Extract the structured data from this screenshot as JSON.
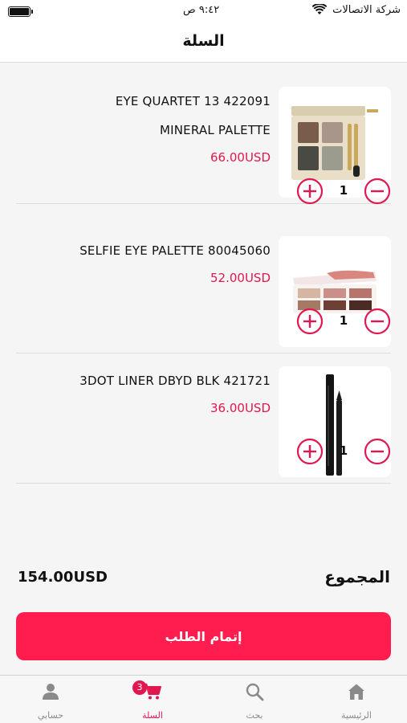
{
  "status_bar": {
    "carrier": "شركة الاتصالات",
    "time": "٩:٤٢ ص"
  },
  "header": {
    "title": "السلة"
  },
  "cart": {
    "items": [
      {
        "name_line1": "422091 13 EYE QUARTET",
        "name_line2": "MINERAL PALETTE",
        "price": "66.00USD",
        "quantity": "1"
      },
      {
        "name_line1": "80045060 SELFIE EYE PALETTE",
        "name_line2": "",
        "price": "52.00USD",
        "quantity": "1"
      },
      {
        "name_line1": "421721 3DOT LINER DBYD BLK",
        "name_line2": "",
        "price": "36.00USD",
        "quantity": "1"
      }
    ]
  },
  "summary": {
    "total_label": "المجموع",
    "total_value": "154.00USD"
  },
  "checkout_button": {
    "label": "إتمام الطلب"
  },
  "tab_bar": {
    "tabs": [
      {
        "label": "الرئيسية",
        "icon": "home-icon"
      },
      {
        "label": "بحث",
        "icon": "search-icon"
      },
      {
        "label": "السلة",
        "icon": "cart-icon",
        "badge": "3",
        "active": true
      },
      {
        "label": "حسابي",
        "icon": "user-icon"
      }
    ]
  },
  "colors": {
    "accent": "#e0184f",
    "button": "#ff1c4f"
  }
}
